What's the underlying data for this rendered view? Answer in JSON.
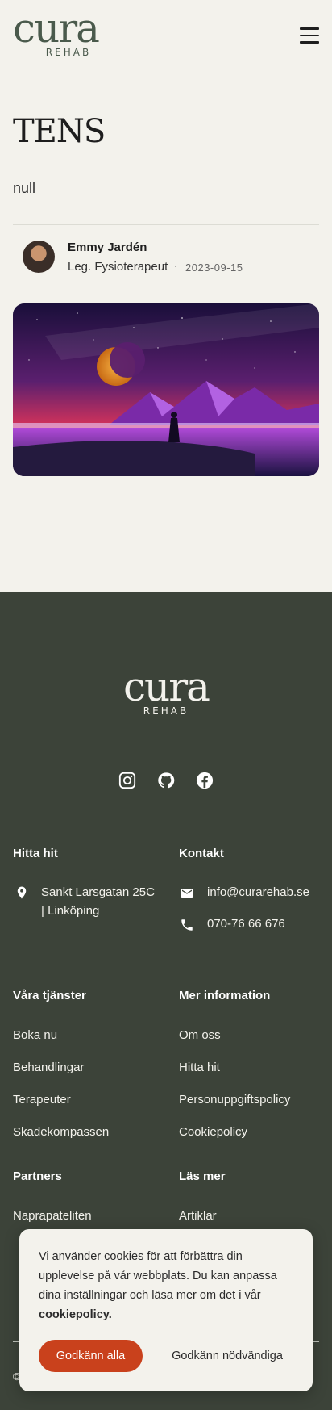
{
  "brand": {
    "name": "cura",
    "sub": "REHAB"
  },
  "article": {
    "title": "TENS",
    "excerpt": "null",
    "author": {
      "name": "Emmy Jardén",
      "role": "Leg. Fysioterapeut",
      "separator": "·",
      "date": "2023-09-15"
    }
  },
  "footer": {
    "find_us": {
      "heading": "Hitta hit",
      "address_line1": "Sankt Larsgatan 25C",
      "address_line2": "| Linköping"
    },
    "contact": {
      "heading": "Kontakt",
      "email": "info@curarehab.se",
      "phone": "070-76 66 676"
    },
    "services": {
      "heading": "Våra tjänster",
      "items": [
        "Boka nu",
        "Behandlingar",
        "Terapeuter",
        "Skadekompassen"
      ]
    },
    "more_info": {
      "heading": "Mer information",
      "items": [
        "Om oss",
        "Hitta hit",
        "Personuppgiftspolicy",
        "Cookiepolicy"
      ]
    },
    "partners": {
      "heading": "Partners",
      "items": [
        "Naprapateliten"
      ]
    },
    "read_more": {
      "heading": "Läs mer",
      "items": [
        "Artiklar"
      ]
    },
    "copyright": "©"
  },
  "cookie_banner": {
    "text": "Vi använder cookies för att förbättra din upplevelse på vår webbplats. Du kan anpassa dina inställningar och läsa mer om det i vår",
    "policy_link": "cookiepolicy.",
    "accept_all": "Godkänn alla",
    "accept_necessary": "Godkänn nödvändiga"
  },
  "colors": {
    "footer_bg": "#3c4339",
    "brand_green": "#4a5a4c",
    "accent": "#c9411c",
    "page_bg": "#f3f2ec"
  },
  "icons": [
    "menu-icon",
    "instagram-icon",
    "github-icon",
    "facebook-icon",
    "location-pin-icon",
    "mail-icon",
    "phone-icon"
  ]
}
